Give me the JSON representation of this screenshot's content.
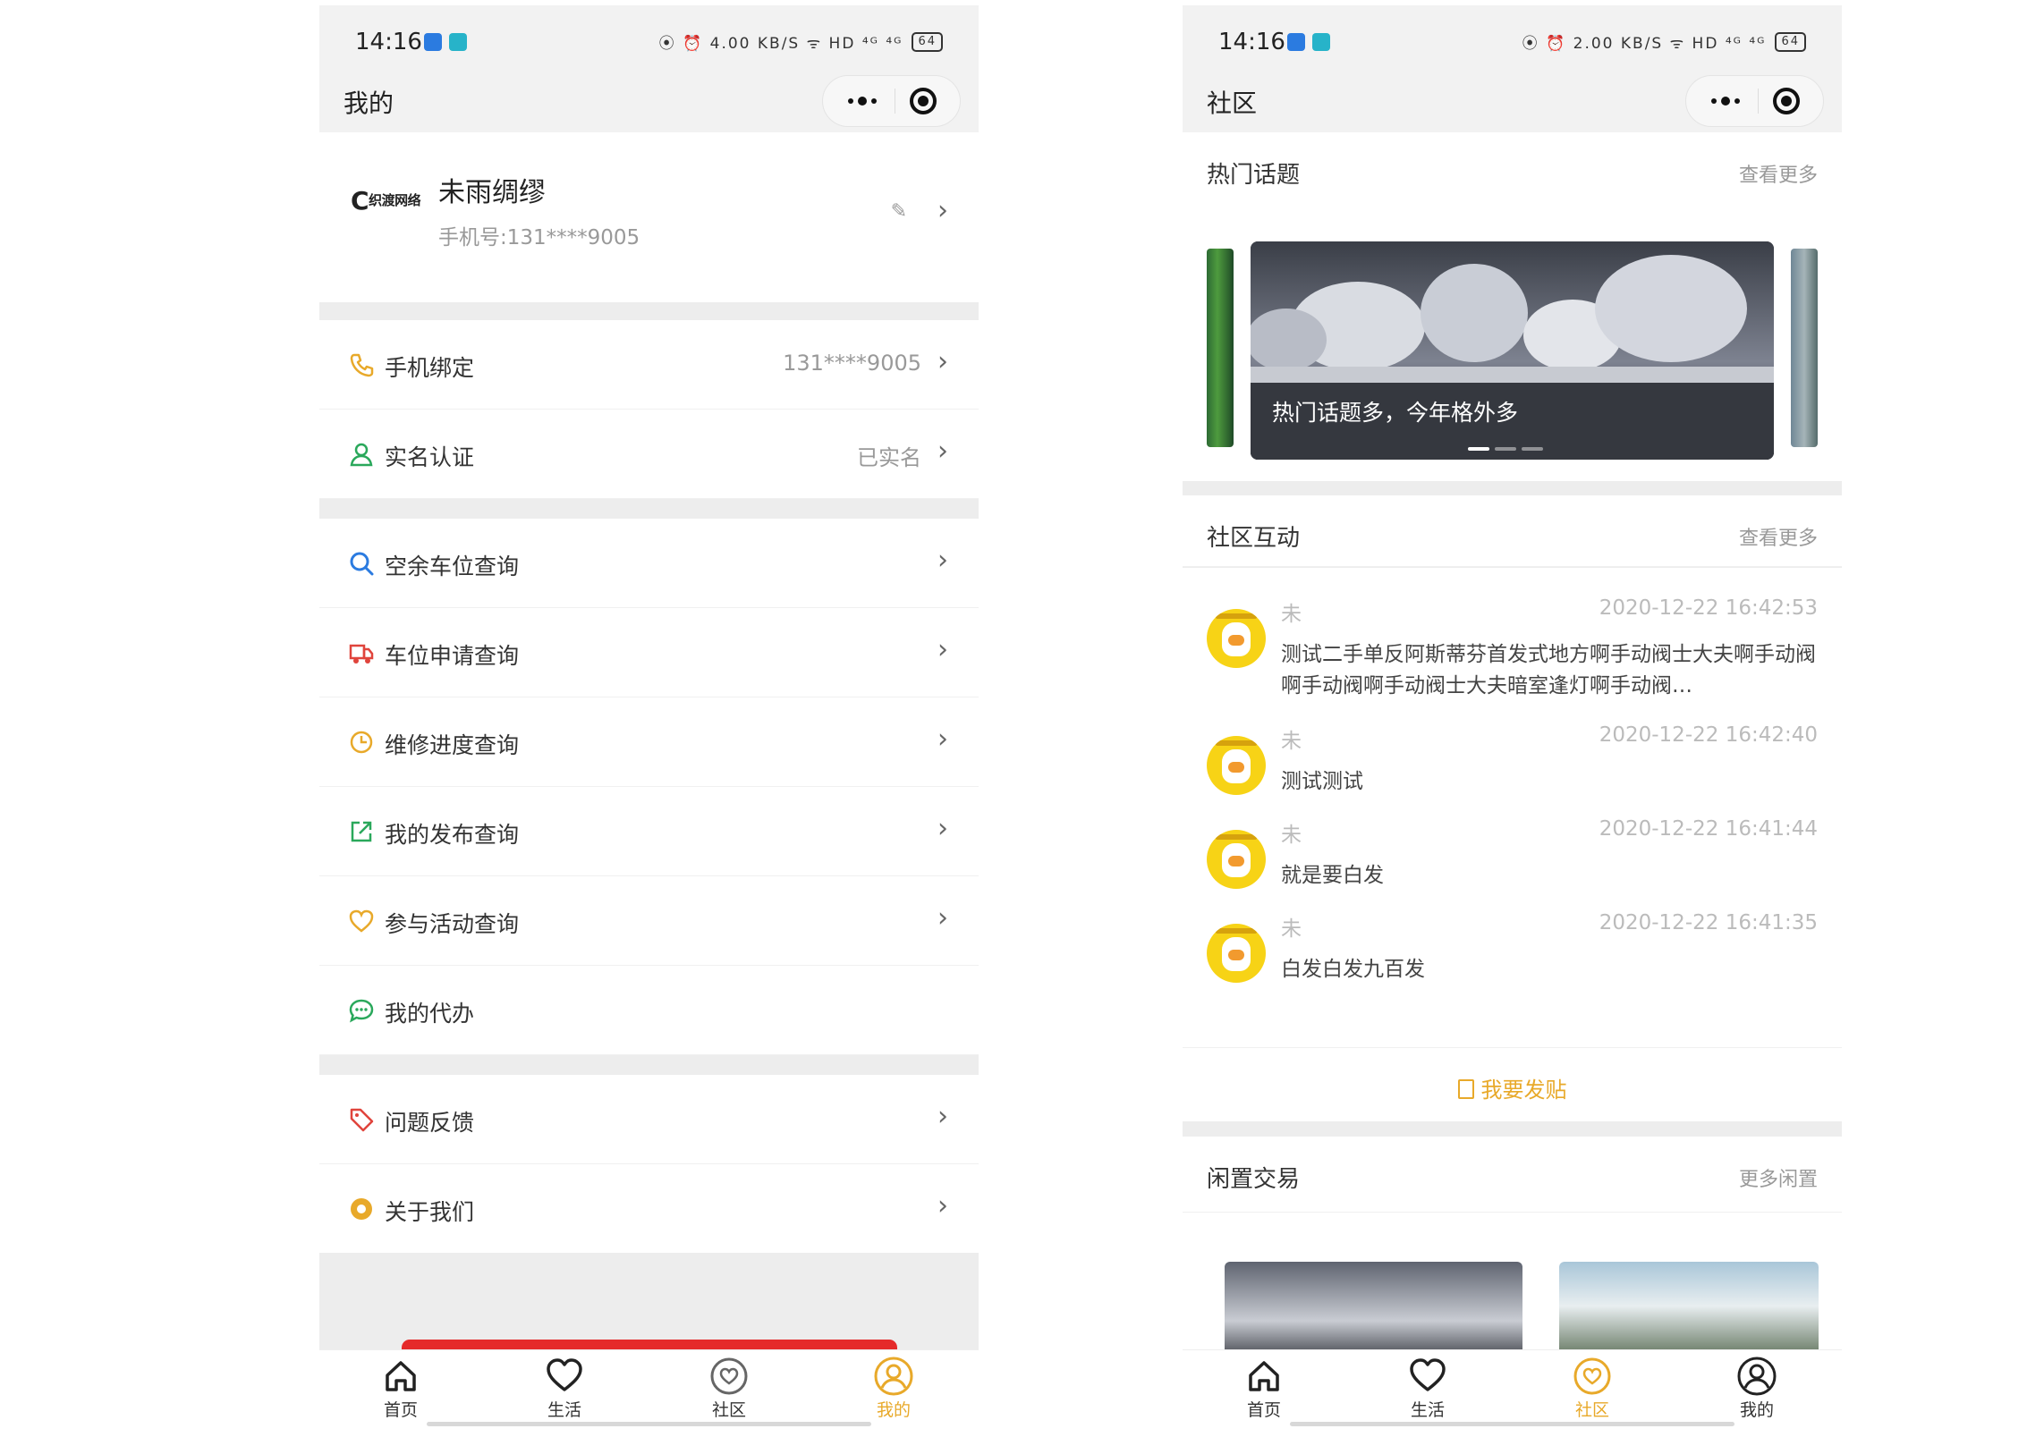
{
  "status": {
    "time": "14:16",
    "left_icons": "⦿ ⏰ 4.00 KB/S ᯤ HD ⁴ᴳ ⁴ᴳ",
    "right_icons": "⦿ ⏰ 2.00 KB/S ᯤ HD ⁴ᴳ ⁴ᴳ",
    "battery": "64"
  },
  "left": {
    "nav_title": "我的",
    "profile": {
      "logo_letter": "C",
      "logo_text": "织渡网络",
      "name": "未雨绸缪",
      "phone": "手机号:131****9005",
      "edit_icon": "pencil-icon"
    },
    "menu": [
      {
        "label": "手机绑定",
        "value": "131****9005",
        "icon": "phone-icon",
        "color": "#e8a92a"
      },
      {
        "label": "实名认证",
        "value": "已实名",
        "icon": "user-icon",
        "color": "#2aa85b"
      },
      {
        "label": "空余车位查询",
        "value": "",
        "icon": "search-icon",
        "color": "#2b7be0"
      },
      {
        "label": "车位申请查询",
        "value": "",
        "icon": "truck-icon",
        "color": "#e0443c"
      },
      {
        "label": "维修进度查询",
        "value": "",
        "icon": "clock-icon",
        "color": "#e8a92a"
      },
      {
        "label": "我的发布查询",
        "value": "",
        "icon": "share-icon",
        "color": "#2aa85b"
      },
      {
        "label": "参与活动查询",
        "value": "",
        "icon": "heart-icon",
        "color": "#e8a92a"
      },
      {
        "label": "我的代办",
        "value": "",
        "icon": "chat-icon",
        "color": "#2aa85b"
      },
      {
        "label": "问题反馈",
        "value": "",
        "icon": "tag-icon",
        "color": "#e0443c"
      },
      {
        "label": "关于我们",
        "value": "",
        "icon": "gear-icon",
        "color": "#e8a92a"
      }
    ]
  },
  "right": {
    "nav_title": "社区",
    "hot": {
      "title": "热门话题",
      "more": "查看更多",
      "caption": "热门话题多，今年格外多"
    },
    "interact": {
      "title": "社区互动",
      "more": "查看更多"
    },
    "posts": [
      {
        "user": "未",
        "time": "2020-12-22 16:42:53",
        "text": "测试二手单反阿斯蒂芬首发式地方啊手动阀士大夫啊手动阀啊手动阀啊手动阀士大夫暗室逢灯啊手动阀…"
      },
      {
        "user": "未",
        "time": "2020-12-22 16:42:40",
        "text": "测试测试"
      },
      {
        "user": "未",
        "time": "2020-12-22 16:41:44",
        "text": "就是要白发"
      },
      {
        "user": "未",
        "time": "2020-12-22 16:41:35",
        "text": "白发白发九百发"
      }
    ],
    "post_button": "我要发贴",
    "idle": {
      "title": "闲置交易",
      "more": "更多闲置"
    }
  },
  "tabs": [
    {
      "label": "首页",
      "icon": "home-icon"
    },
    {
      "label": "生活",
      "icon": "heart-icon"
    },
    {
      "label": "社区",
      "icon": "community-icon"
    },
    {
      "label": "我的",
      "icon": "profile-icon"
    }
  ],
  "colors": {
    "accent": "#e8a92a",
    "green": "#2aa85b",
    "red": "#e52a2a"
  }
}
